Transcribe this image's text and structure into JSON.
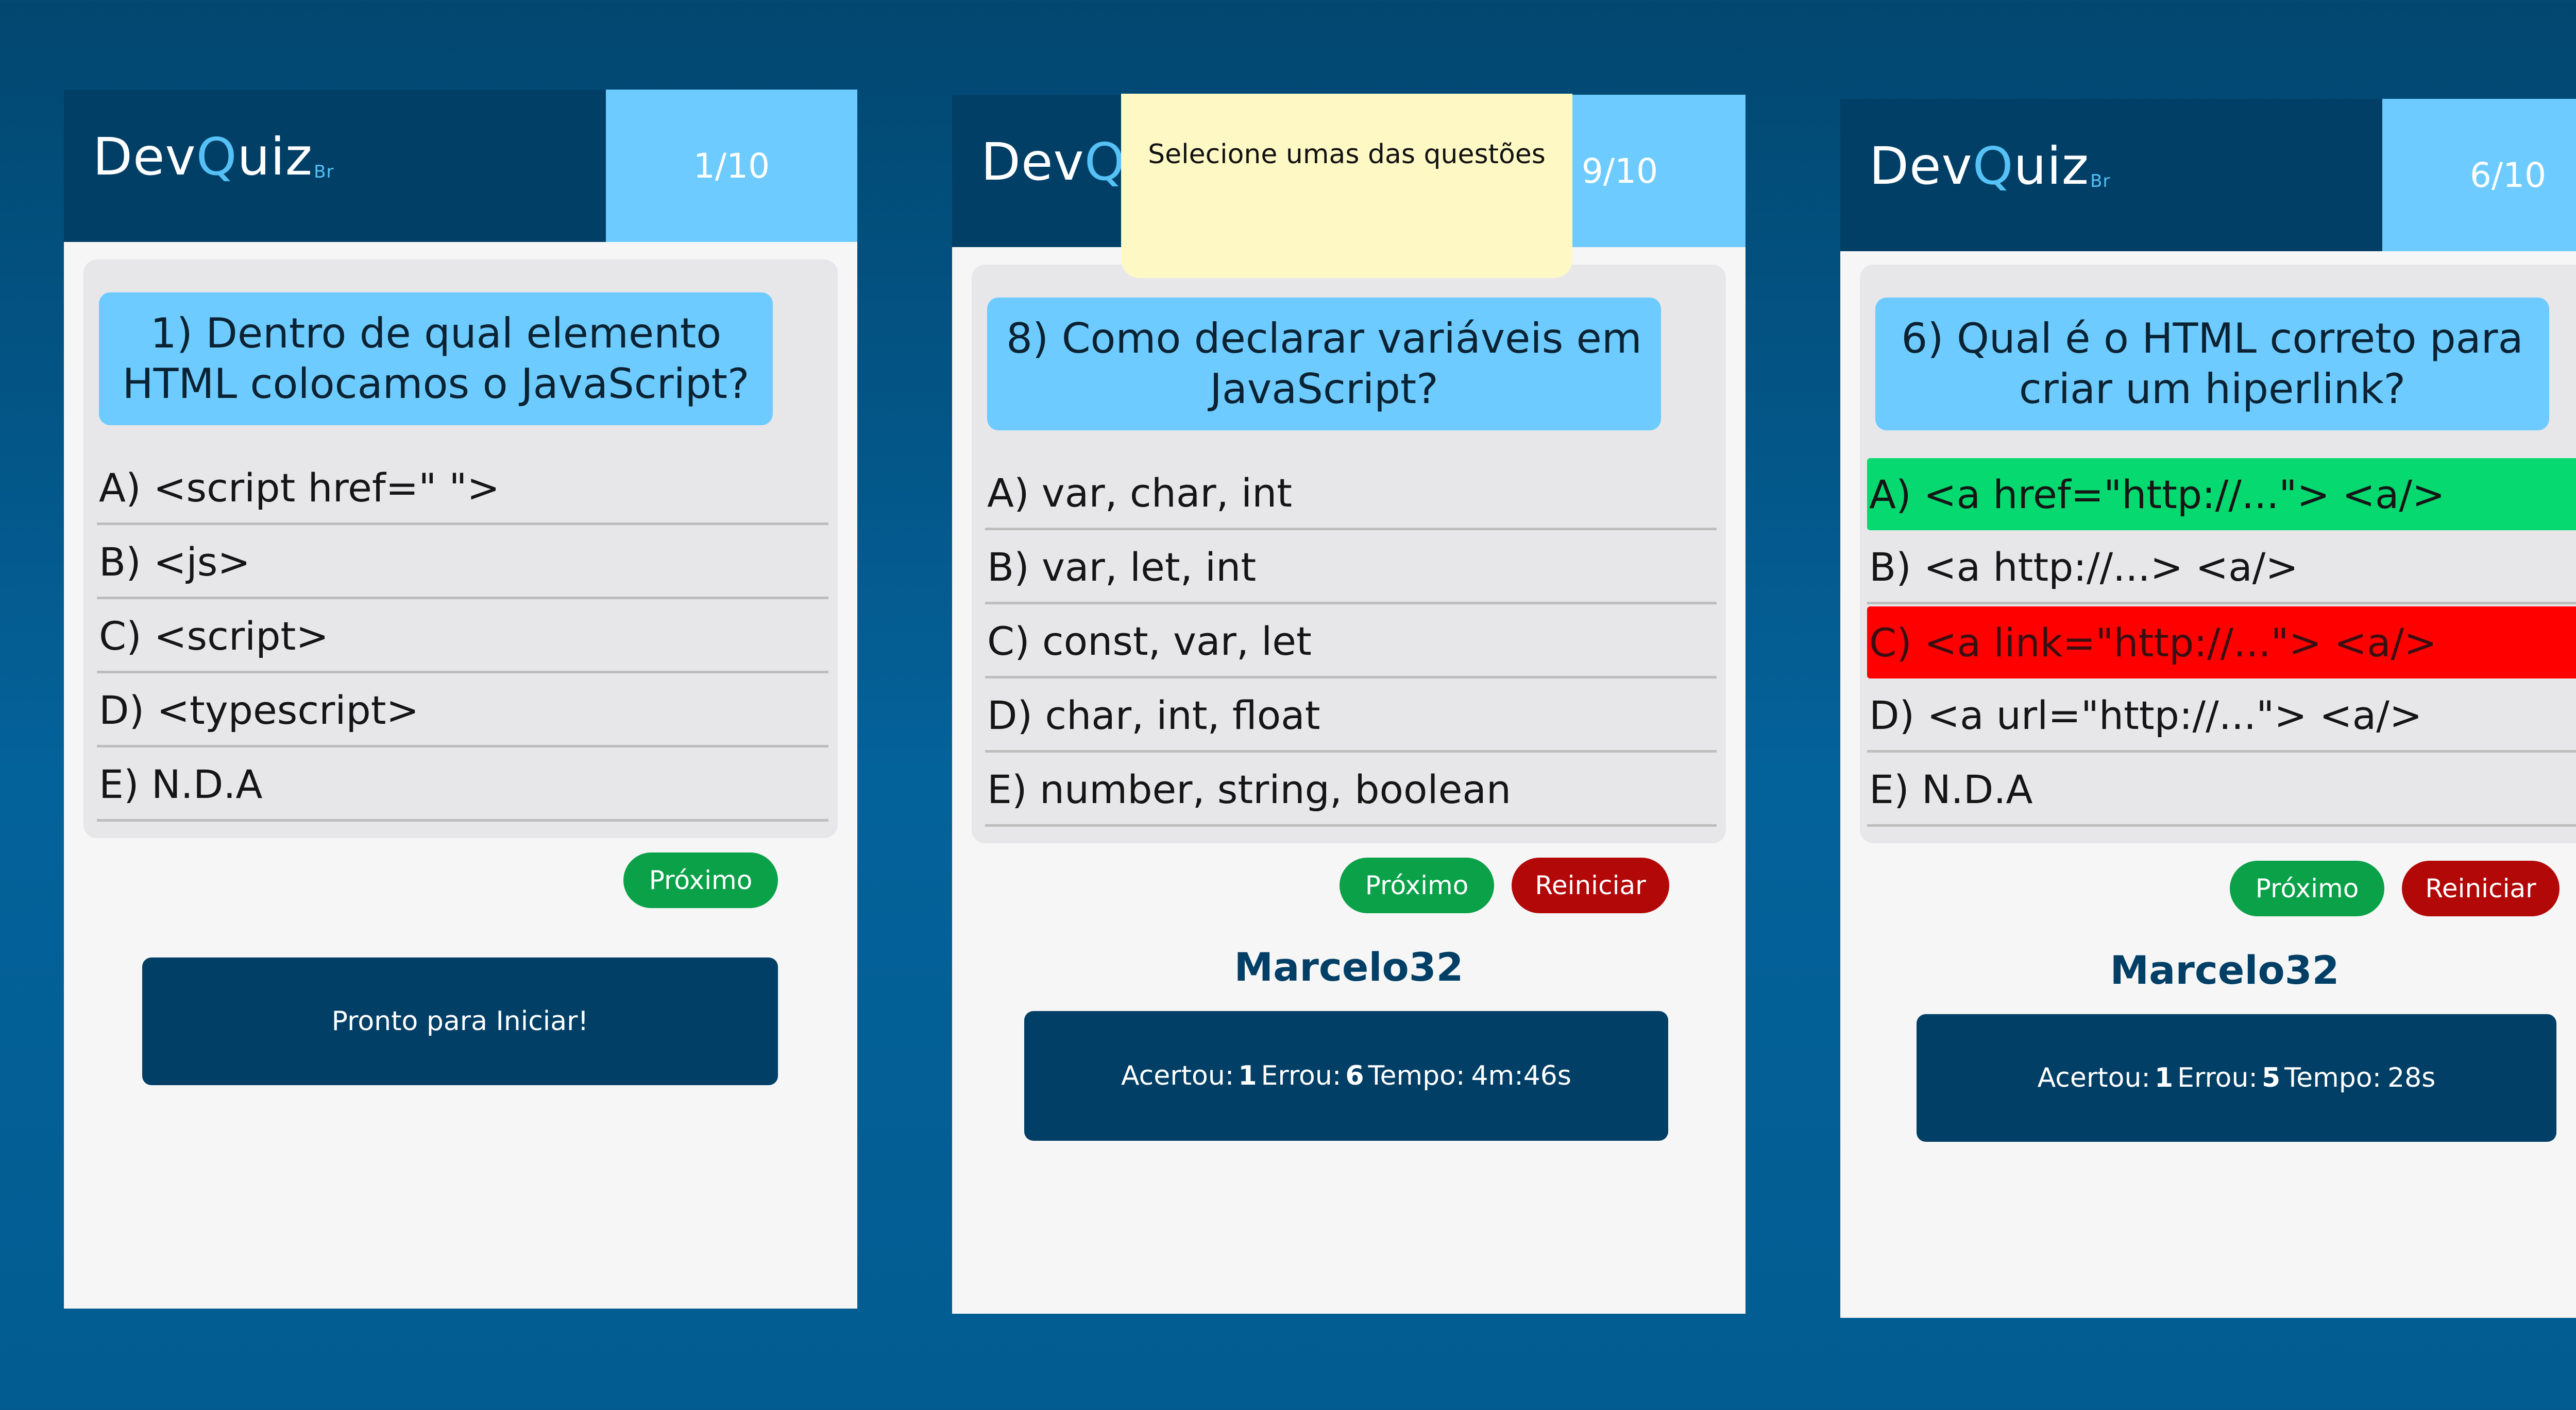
{
  "cards": [
    {
      "logo": {
        "prefix": "Dev",
        "q": "Q",
        "suffix": "uiz",
        "sub": "Br"
      },
      "counter": "1/10",
      "question": "1) Dentro de qual elemento HTML colocamos o JavaScript?",
      "options": [
        "A) <script href=\" \">",
        "B) <js>",
        "C) <script>",
        "D) <typescript>",
        "E) N.D.A"
      ],
      "next_label": "Próximo",
      "start_label": "Pronto para Iniciar!"
    },
    {
      "logo": {
        "prefix": "Dev",
        "q": "Q"
      },
      "counter": "9/10",
      "question": "8) Como declarar variáveis em JavaScript?",
      "options": [
        "A) var, char, int",
        "B) var, let, int",
        "C) const, var, let",
        "D) char, int, float",
        "E) number, string, boolean"
      ],
      "next_label": "Próximo",
      "restart_label": "Reiniciar",
      "player": "Marcelo32",
      "stats": {
        "hits_label": "Acertou:",
        "hits": "1",
        "misses_label": "Errou:",
        "misses": "6",
        "time_label": "Tempo:",
        "time": "4m:46s"
      }
    },
    {
      "logo": {
        "prefix": "Dev",
        "q": "Q",
        "suffix": "uiz",
        "sub": "Br"
      },
      "counter": "6/10",
      "question": "6) Qual é o HTML correto para criar um hiperlink?",
      "options": [
        "A) <a href=\"http://...\"> <a/>",
        "B) <a http://...> <a/>",
        "C) <a link=\"http://...\"> <a/>",
        "D) <a url=\"http://...\"> <a/>",
        "E) N.D.A"
      ],
      "next_label": "Próximo",
      "restart_label": "Reiniciar",
      "player": "Marcelo32",
      "stats": {
        "hits_label": "Acertou:",
        "hits": "1",
        "misses_label": "Errou:",
        "misses": "5",
        "time_label": "Tempo:",
        "time": "28s"
      }
    }
  ],
  "tooltip": "Selecione umas das questões",
  "colors": {
    "background": "#025c91",
    "header": "#013f66",
    "counter": "#6dcbff",
    "correct": "#05d96f",
    "wrong": "#ff0000",
    "next_button": "#0aa148",
    "restart_button": "#b30808",
    "tooltip": "#fef9c4"
  }
}
